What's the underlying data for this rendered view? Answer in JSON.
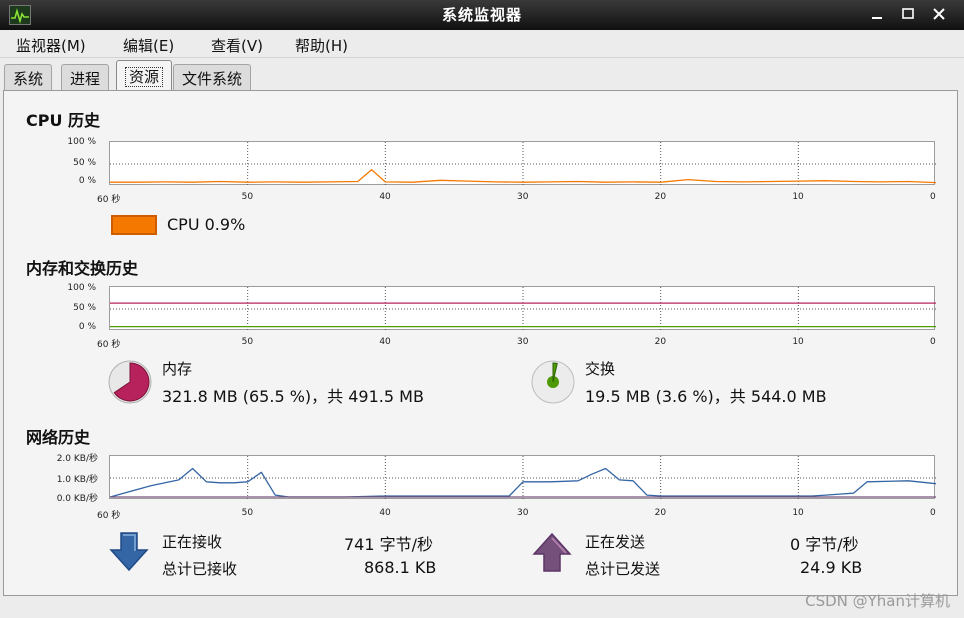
{
  "window": {
    "title": "系统监视器",
    "minimize_icon": "minimize-icon",
    "maximize_icon": "maximize-icon",
    "close_icon": "close-icon"
  },
  "menu": {
    "items": [
      "监视器(M)",
      "编辑(E)",
      "查看(V)",
      "帮助(H)"
    ]
  },
  "tabs": {
    "items": [
      "系统",
      "进程",
      "资源",
      "文件系统"
    ],
    "active": "资源"
  },
  "cpu": {
    "title": "CPU 历史",
    "y_ticks": [
      "100 %",
      "50 %",
      "0 %"
    ],
    "x_ticks": [
      "60 秒",
      "50",
      "40",
      "30",
      "20",
      "10",
      "0"
    ],
    "legend": "CPU  0.9%",
    "color": "#f57900"
  },
  "memory": {
    "title": "内存和交换历史",
    "y_ticks": [
      "100 %",
      "50 %",
      "0 %"
    ],
    "x_ticks": [
      "60 秒",
      "50",
      "40",
      "30",
      "20",
      "10",
      "0"
    ],
    "mem_label": "内存",
    "mem_value": "321.8 MB (65.5 %)，共 491.5 MB",
    "swap_label": "交换",
    "swap_value": "19.5 MB (3.6 %)，共 544.0 MB",
    "mem_color": "#b8225c",
    "swap_color": "#4e9a06"
  },
  "network": {
    "title": "网络历史",
    "y_ticks": [
      "2.0 KB/秒",
      "1.0 KB/秒",
      "0.0 KB/秒"
    ],
    "x_ticks": [
      "60 秒",
      "50",
      "40",
      "30",
      "20",
      "10",
      "0"
    ],
    "recv_label": "正在接收",
    "recv_rate": "741 字节/秒",
    "recv_total_label": "总计已接收",
    "recv_total": "868.1 KB",
    "send_label": "正在发送",
    "send_rate": "0 字节/秒",
    "send_total_label": "总计已发送",
    "send_total": "24.9 KB",
    "recv_color": "#3465a4",
    "send_color": "#75507b"
  },
  "watermark": "CSDN @Yhan计算机",
  "chart_data": [
    {
      "type": "line",
      "title": "CPU 历史",
      "x_unit": "seconds ago",
      "x": [
        60,
        58,
        56,
        54,
        52,
        50,
        48,
        46,
        44,
        42,
        41,
        40,
        38,
        36,
        34,
        32,
        30,
        28,
        26,
        24,
        22,
        20,
        18,
        16,
        14,
        12,
        10,
        8,
        6,
        4,
        2,
        0
      ],
      "series": [
        {
          "name": "CPU",
          "values": [
            2,
            2,
            3,
            2,
            4,
            2,
            3,
            2,
            3,
            4,
            35,
            3,
            2,
            7,
            5,
            3,
            2,
            3,
            4,
            2,
            3,
            2,
            9,
            4,
            3,
            4,
            5,
            6,
            4,
            3,
            4,
            1
          ]
        }
      ],
      "ylim": [
        0,
        100
      ],
      "grid": true
    },
    {
      "type": "line",
      "title": "内存和交换历史",
      "x_unit": "seconds ago",
      "x": [
        60,
        0
      ],
      "series": [
        {
          "name": "内存",
          "values": [
            65.5,
            65.5
          ]
        },
        {
          "name": "交换",
          "values": [
            3.6,
            3.6
          ]
        }
      ],
      "ylim": [
        0,
        100
      ],
      "grid": true
    },
    {
      "type": "line",
      "title": "网络历史",
      "x_unit": "seconds ago",
      "x": [
        60,
        57,
        55,
        54,
        53,
        52,
        51,
        50,
        49,
        48,
        47,
        46,
        43,
        40,
        35,
        31,
        30,
        28,
        26,
        25,
        24,
        23,
        22,
        21,
        20,
        19,
        15,
        12,
        10,
        9,
        8,
        7,
        6,
        5,
        2,
        0
      ],
      "series": [
        {
          "name": "正在接收",
          "values": [
            0,
            0.6,
            0.9,
            1.5,
            0.8,
            0.75,
            0.75,
            0.8,
            1.3,
            0.1,
            0,
            0,
            0,
            0.05,
            0.05,
            0.05,
            0.8,
            0.8,
            0.85,
            1.2,
            1.5,
            0.9,
            0.85,
            0.1,
            0.05,
            0.05,
            0.05,
            0.05,
            0.05,
            0.05,
            0.1,
            0.15,
            0.2,
            0.8,
            0.85,
            0.7
          ]
        },
        {
          "name": "正在发送",
          "values": [
            0,
            0,
            0,
            0,
            0,
            0,
            0,
            0,
            0,
            0,
            0,
            0,
            0,
            0,
            0,
            0,
            0,
            0,
            0,
            0,
            0,
            0,
            0,
            0,
            0,
            0,
            0,
            0,
            0,
            0,
            0,
            0,
            0,
            0,
            0,
            0
          ]
        }
      ],
      "ylim": [
        0,
        2.0
      ],
      "grid": true
    }
  ]
}
